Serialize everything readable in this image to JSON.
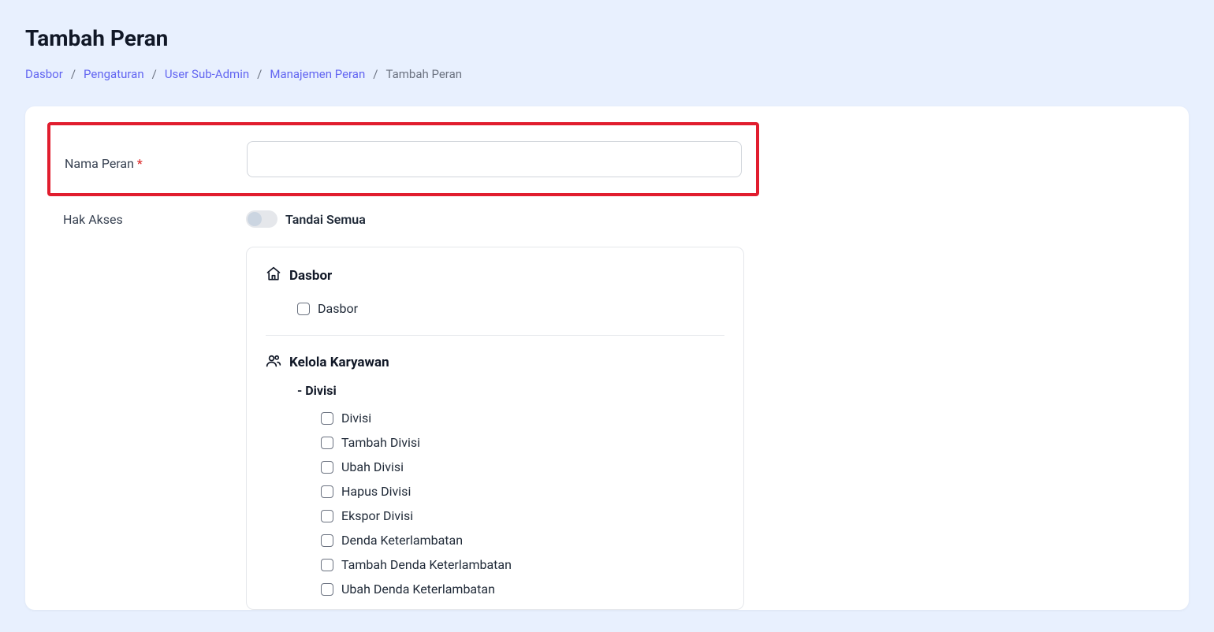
{
  "page": {
    "title": "Tambah Peran"
  },
  "breadcrumb": {
    "items": [
      {
        "label": "Dasbor"
      },
      {
        "label": "Pengaturan"
      },
      {
        "label": "User Sub-Admin"
      },
      {
        "label": "Manajemen Peran"
      }
    ],
    "current": "Tambah Peran",
    "sep": "/"
  },
  "form": {
    "nama_peran_label": "Nama Peran",
    "required_mark": "*",
    "nama_peran_value": "",
    "hak_akses_label": "Hak Akses",
    "tandai_semua_label": "Tandai Semua"
  },
  "permissions": {
    "sections": [
      {
        "icon": "home",
        "title": "Dasbor",
        "items": [
          "Dasbor"
        ]
      },
      {
        "icon": "users",
        "title": "Kelola Karyawan",
        "subsections": [
          {
            "title": "- Divisi",
            "items": [
              "Divisi",
              "Tambah Divisi",
              "Ubah Divisi",
              "Hapus Divisi",
              "Ekspor Divisi",
              "Denda Keterlambatan",
              "Tambah Denda Keterlambatan",
              "Ubah Denda Keterlambatan"
            ]
          }
        ]
      }
    ]
  }
}
